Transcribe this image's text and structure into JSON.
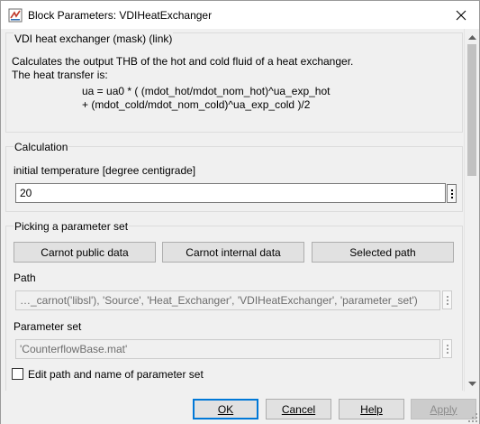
{
  "window": {
    "title": "Block Parameters: VDIHeatExchanger"
  },
  "mask": {
    "group_title": "VDI heat exchanger (mask) (link)",
    "description_line1": "Calculates the output THB of the hot and cold fluid of a heat exchanger.",
    "description_line2": "The heat transfer is:",
    "formula_line1": "ua = ua0 * ( (mdot_hot/mdot_nom_hot)^ua_exp_hot",
    "formula_line2": "+ (mdot_cold/mdot_nom_cold)^ua_exp_cold )/2"
  },
  "calculation": {
    "group_title": "Calculation",
    "initial_temp_label": "initial temperature [degree centigrade]",
    "initial_temp_value": "20"
  },
  "parameter_set": {
    "group_title": "Picking a parameter set",
    "buttons": {
      "carnot_public": "Carnot public data",
      "carnot_internal": "Carnot internal data",
      "selected_path": "Selected path"
    },
    "path_label": "Path",
    "path_value": "…_carnot('libsl'), 'Source', 'Heat_Exchanger', 'VDIHeatExchanger', 'parameter_set')",
    "param_set_label": "Parameter set",
    "param_set_value": "'CounterflowBase.mat'",
    "edit_checkbox_label": "Edit path and name of parameter set",
    "edit_checkbox_checked": false
  },
  "footer": {
    "ok_label": "OK",
    "cancel_label": "Cancel",
    "help_label": "Help",
    "apply_label": "Apply"
  },
  "colors": {
    "focus_border": "#0078d7",
    "simulink_icon_red": "#c0392b"
  },
  "icons": {
    "app": "simulink-block-icon",
    "close": "close-icon",
    "scroll_up": "scroll-up-arrow-icon",
    "scroll_down": "scroll-down-arrow-icon",
    "browse": "ellipsis-menu-icon"
  }
}
